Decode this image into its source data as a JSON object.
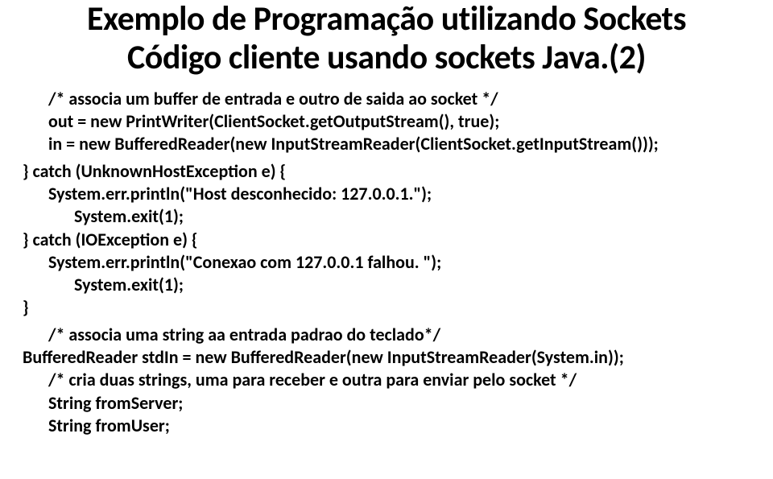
{
  "title": {
    "line1": "Exemplo de Programação utilizando Sockets",
    "line2": "Código cliente usando sockets Java.(2)"
  },
  "code": {
    "l01": "/* associa um buffer de entrada e outro de saida ao socket */",
    "l02": "out = new PrintWriter(ClientSocket.getOutputStream(), true);",
    "l03": "in = new BufferedReader(new InputStreamReader(ClientSocket.getInputStream()));",
    "l04": "} catch (UnknownHostException e) {",
    "l05": "System.err.println(\"Host desconhecido: 127.0.0.1.\");",
    "l06": "System.exit(1);",
    "l07": "} catch (IOException e) {",
    "l08": "System.err.println(\"Conexao com 127.0.0.1 falhou. \");",
    "l09": "System.exit(1);",
    "l10": "}",
    "l11": "/* associa uma string aa entrada padrao do teclado*/",
    "l12": "BufferedReader stdIn = new BufferedReader(new InputStreamReader(System.in));",
    "l13": "/* cria duas strings, uma para receber e outra para enviar pelo socket */",
    "l14": "String fromServer;",
    "l15": "String fromUser;"
  }
}
